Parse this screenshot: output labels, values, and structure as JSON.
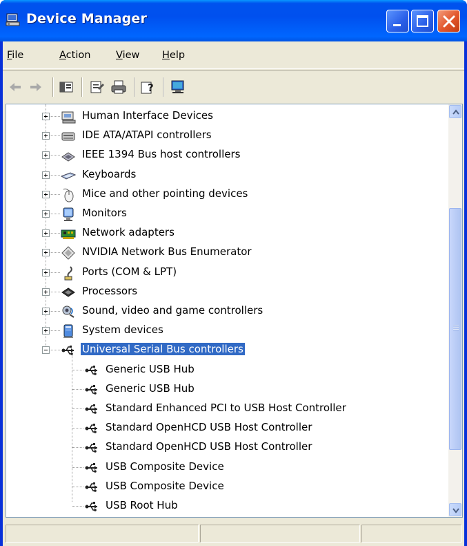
{
  "window": {
    "title": "Device Manager"
  },
  "menu": {
    "file": "File",
    "action": "Action",
    "view": "View",
    "help": "Help"
  },
  "toolbar": {
    "icons": [
      "back-icon",
      "forward-icon",
      "show-hide-tree-icon",
      "properties-icon",
      "print-icon",
      "help-icon",
      "scan-hardware-icon"
    ]
  },
  "tree": {
    "categories": [
      {
        "label": "Human Interface Devices",
        "icon": "hid-icon",
        "expanded": false
      },
      {
        "label": "IDE ATA/ATAPI controllers",
        "icon": "ide-controller-icon",
        "expanded": false
      },
      {
        "label": "IEEE 1394 Bus host controllers",
        "icon": "ieee1394-icon",
        "expanded": false
      },
      {
        "label": "Keyboards",
        "icon": "keyboard-icon",
        "expanded": false
      },
      {
        "label": "Mice and other pointing devices",
        "icon": "mouse-icon",
        "expanded": false
      },
      {
        "label": "Monitors",
        "icon": "monitor-icon",
        "expanded": false
      },
      {
        "label": "Network adapters",
        "icon": "network-adapter-icon",
        "expanded": false
      },
      {
        "label": "NVIDIA Network Bus Enumerator",
        "icon": "bus-enumerator-icon",
        "expanded": false
      },
      {
        "label": "Ports (COM & LPT)",
        "icon": "port-icon",
        "expanded": false
      },
      {
        "label": "Processors",
        "icon": "processor-icon",
        "expanded": false
      },
      {
        "label": "Sound, video and game controllers",
        "icon": "sound-icon",
        "expanded": false
      },
      {
        "label": "System devices",
        "icon": "system-device-icon",
        "expanded": false
      },
      {
        "label": "Universal Serial Bus controllers",
        "icon": "usb-icon",
        "expanded": true,
        "selected": true
      }
    ],
    "usb_children": [
      "Generic USB Hub",
      "Generic USB Hub",
      "Standard Enhanced PCI to USB Host Controller",
      "Standard OpenHCD USB Host Controller",
      "Standard OpenHCD USB Host Controller",
      "USB Composite Device",
      "USB Composite Device",
      "USB Root Hub"
    ]
  },
  "colors": {
    "title_bar": "#0054e3",
    "selection": "#316ac5",
    "face": "#ece9d8"
  }
}
